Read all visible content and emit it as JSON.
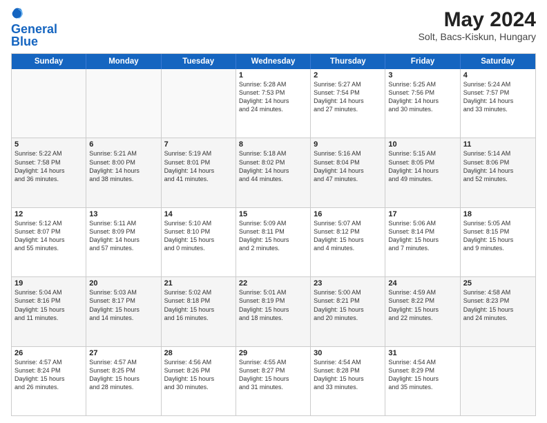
{
  "logo": {
    "line1": "General",
    "line2": "Blue"
  },
  "title": "May 2024",
  "subtitle": "Solt, Bacs-Kiskun, Hungary",
  "days": [
    "Sunday",
    "Monday",
    "Tuesday",
    "Wednesday",
    "Thursday",
    "Friday",
    "Saturday"
  ],
  "weeks": [
    [
      {
        "day": "",
        "text": ""
      },
      {
        "day": "",
        "text": ""
      },
      {
        "day": "",
        "text": ""
      },
      {
        "day": "1",
        "text": "Sunrise: 5:28 AM\nSunset: 7:53 PM\nDaylight: 14 hours\nand 24 minutes."
      },
      {
        "day": "2",
        "text": "Sunrise: 5:27 AM\nSunset: 7:54 PM\nDaylight: 14 hours\nand 27 minutes."
      },
      {
        "day": "3",
        "text": "Sunrise: 5:25 AM\nSunset: 7:56 PM\nDaylight: 14 hours\nand 30 minutes."
      },
      {
        "day": "4",
        "text": "Sunrise: 5:24 AM\nSunset: 7:57 PM\nDaylight: 14 hours\nand 33 minutes."
      }
    ],
    [
      {
        "day": "5",
        "text": "Sunrise: 5:22 AM\nSunset: 7:58 PM\nDaylight: 14 hours\nand 36 minutes."
      },
      {
        "day": "6",
        "text": "Sunrise: 5:21 AM\nSunset: 8:00 PM\nDaylight: 14 hours\nand 38 minutes."
      },
      {
        "day": "7",
        "text": "Sunrise: 5:19 AM\nSunset: 8:01 PM\nDaylight: 14 hours\nand 41 minutes."
      },
      {
        "day": "8",
        "text": "Sunrise: 5:18 AM\nSunset: 8:02 PM\nDaylight: 14 hours\nand 44 minutes."
      },
      {
        "day": "9",
        "text": "Sunrise: 5:16 AM\nSunset: 8:04 PM\nDaylight: 14 hours\nand 47 minutes."
      },
      {
        "day": "10",
        "text": "Sunrise: 5:15 AM\nSunset: 8:05 PM\nDaylight: 14 hours\nand 49 minutes."
      },
      {
        "day": "11",
        "text": "Sunrise: 5:14 AM\nSunset: 8:06 PM\nDaylight: 14 hours\nand 52 minutes."
      }
    ],
    [
      {
        "day": "12",
        "text": "Sunrise: 5:12 AM\nSunset: 8:07 PM\nDaylight: 14 hours\nand 55 minutes."
      },
      {
        "day": "13",
        "text": "Sunrise: 5:11 AM\nSunset: 8:09 PM\nDaylight: 14 hours\nand 57 minutes."
      },
      {
        "day": "14",
        "text": "Sunrise: 5:10 AM\nSunset: 8:10 PM\nDaylight: 15 hours\nand 0 minutes."
      },
      {
        "day": "15",
        "text": "Sunrise: 5:09 AM\nSunset: 8:11 PM\nDaylight: 15 hours\nand 2 minutes."
      },
      {
        "day": "16",
        "text": "Sunrise: 5:07 AM\nSunset: 8:12 PM\nDaylight: 15 hours\nand 4 minutes."
      },
      {
        "day": "17",
        "text": "Sunrise: 5:06 AM\nSunset: 8:14 PM\nDaylight: 15 hours\nand 7 minutes."
      },
      {
        "day": "18",
        "text": "Sunrise: 5:05 AM\nSunset: 8:15 PM\nDaylight: 15 hours\nand 9 minutes."
      }
    ],
    [
      {
        "day": "19",
        "text": "Sunrise: 5:04 AM\nSunset: 8:16 PM\nDaylight: 15 hours\nand 11 minutes."
      },
      {
        "day": "20",
        "text": "Sunrise: 5:03 AM\nSunset: 8:17 PM\nDaylight: 15 hours\nand 14 minutes."
      },
      {
        "day": "21",
        "text": "Sunrise: 5:02 AM\nSunset: 8:18 PM\nDaylight: 15 hours\nand 16 minutes."
      },
      {
        "day": "22",
        "text": "Sunrise: 5:01 AM\nSunset: 8:19 PM\nDaylight: 15 hours\nand 18 minutes."
      },
      {
        "day": "23",
        "text": "Sunrise: 5:00 AM\nSunset: 8:21 PM\nDaylight: 15 hours\nand 20 minutes."
      },
      {
        "day": "24",
        "text": "Sunrise: 4:59 AM\nSunset: 8:22 PM\nDaylight: 15 hours\nand 22 minutes."
      },
      {
        "day": "25",
        "text": "Sunrise: 4:58 AM\nSunset: 8:23 PM\nDaylight: 15 hours\nand 24 minutes."
      }
    ],
    [
      {
        "day": "26",
        "text": "Sunrise: 4:57 AM\nSunset: 8:24 PM\nDaylight: 15 hours\nand 26 minutes."
      },
      {
        "day": "27",
        "text": "Sunrise: 4:57 AM\nSunset: 8:25 PM\nDaylight: 15 hours\nand 28 minutes."
      },
      {
        "day": "28",
        "text": "Sunrise: 4:56 AM\nSunset: 8:26 PM\nDaylight: 15 hours\nand 30 minutes."
      },
      {
        "day": "29",
        "text": "Sunrise: 4:55 AM\nSunset: 8:27 PM\nDaylight: 15 hours\nand 31 minutes."
      },
      {
        "day": "30",
        "text": "Sunrise: 4:54 AM\nSunset: 8:28 PM\nDaylight: 15 hours\nand 33 minutes."
      },
      {
        "day": "31",
        "text": "Sunrise: 4:54 AM\nSunset: 8:29 PM\nDaylight: 15 hours\nand 35 minutes."
      },
      {
        "day": "",
        "text": ""
      }
    ]
  ]
}
